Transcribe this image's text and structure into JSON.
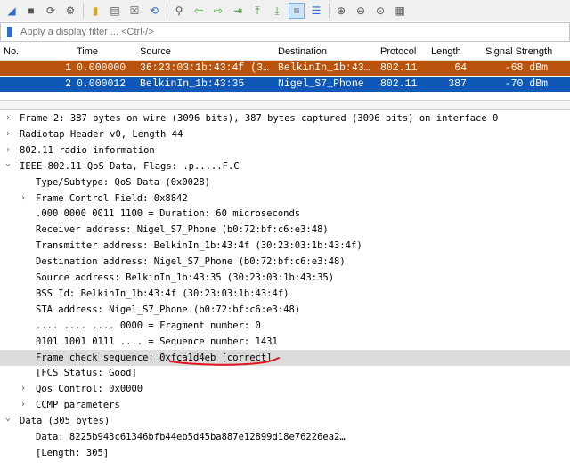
{
  "toolbar": {
    "icons": [
      "shark-fin-icon",
      "stop-icon",
      "restart-icon",
      "options-icon",
      "open-folder-icon",
      "file-icon",
      "close-file-icon",
      "reload-icon",
      "find-icon",
      "back-icon",
      "forward-icon",
      "go-to-packet-icon",
      "first-packet-icon",
      "last-packet-icon",
      "autoscroll-icon",
      "colorize-icon",
      "zoom-in-icon",
      "zoom-out-icon",
      "normal-size-icon",
      "resize-columns-icon"
    ]
  },
  "filter": {
    "placeholder": "Apply a display filter ... <Ctrl-/>"
  },
  "packet_list": {
    "columns": [
      "No.",
      "Time",
      "Source",
      "Destination",
      "Protocol",
      "Length",
      "Signal Strength"
    ],
    "rows": [
      {
        "no": "1",
        "time": "0.000000",
        "source": "36:23:03:1b:43:4f (3…",
        "destination": "BelkinIn_1b:43…",
        "protocol": "802.11",
        "length": "64",
        "signal": "-68 dBm",
        "color": "#b8520c"
      },
      {
        "no": "2",
        "time": "0.000012",
        "source": "BelkinIn_1b:43:35",
        "destination": "Nigel_S7_Phone",
        "protocol": "802.11",
        "length": "387",
        "signal": "-70 dBm",
        "color": "#0f58b8"
      }
    ]
  },
  "details": {
    "lines": [
      {
        "indent": 0,
        "arrow": ">",
        "text": "Frame 2: 387 bytes on wire (3096 bits), 387 bytes captured (3096 bits) on interface 0"
      },
      {
        "indent": 0,
        "arrow": ">",
        "text": "Radiotap Header v0, Length 44"
      },
      {
        "indent": 0,
        "arrow": ">",
        "text": "802.11 radio information"
      },
      {
        "indent": 0,
        "arrow": "v",
        "text": "IEEE 802.11 QoS Data, Flags: .p.....F.C"
      },
      {
        "indent": 1,
        "arrow": "",
        "text": "Type/Subtype: QoS Data (0x0028)"
      },
      {
        "indent": 1,
        "arrow": ">",
        "text": "Frame Control Field: 0x8842"
      },
      {
        "indent": 1,
        "arrow": "",
        "text": ".000 0000 0011 1100 = Duration: 60 microseconds"
      },
      {
        "indent": 1,
        "arrow": "",
        "text": "Receiver address: Nigel_S7_Phone (b0:72:bf:c6:e3:48)"
      },
      {
        "indent": 1,
        "arrow": "",
        "text": "Transmitter address: BelkinIn_1b:43:4f (30:23:03:1b:43:4f)"
      },
      {
        "indent": 1,
        "arrow": "",
        "text": "Destination address: Nigel_S7_Phone (b0:72:bf:c6:e3:48)"
      },
      {
        "indent": 1,
        "arrow": "",
        "text": "Source address: BelkinIn_1b:43:35 (30:23:03:1b:43:35)"
      },
      {
        "indent": 1,
        "arrow": "",
        "text": "BSS Id: BelkinIn_1b:43:4f (30:23:03:1b:43:4f)"
      },
      {
        "indent": 1,
        "arrow": "",
        "text": "STA address: Nigel_S7_Phone (b0:72:bf:c6:e3:48)"
      },
      {
        "indent": 1,
        "arrow": "",
        "text": ".... .... .... 0000 = Fragment number: 0"
      },
      {
        "indent": 1,
        "arrow": "",
        "text": "0101 1001 0111 .... = Sequence number: 1431"
      },
      {
        "indent": 1,
        "arrow": "",
        "text": "Frame check sequence: 0xfca1d4eb [correct]",
        "highlight": true
      },
      {
        "indent": 1,
        "arrow": "",
        "text": "[FCS Status: Good]"
      },
      {
        "indent": 1,
        "arrow": ">",
        "text": "Qos Control: 0x0000"
      },
      {
        "indent": 1,
        "arrow": ">",
        "text": "CCMP parameters"
      },
      {
        "indent": 0,
        "arrow": "v",
        "text": "Data (305 bytes)"
      },
      {
        "indent": 1,
        "arrow": "",
        "text": "Data: 8225b943c61346bfb44eb5d45ba887e12899d18e76226ea2…"
      },
      {
        "indent": 1,
        "arrow": "",
        "text": "[Length: 305]"
      }
    ]
  }
}
